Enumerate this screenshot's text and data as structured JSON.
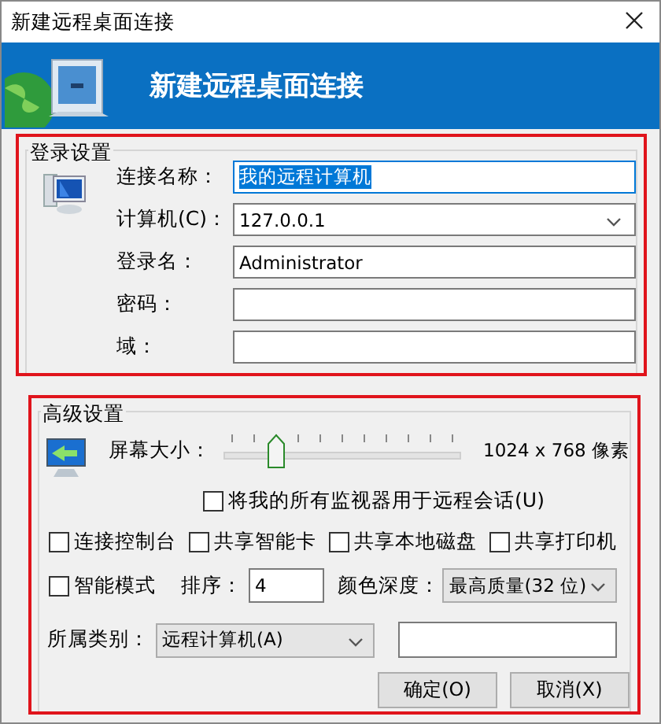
{
  "window": {
    "title": "新建远程桌面连接"
  },
  "banner": {
    "title": "新建远程桌面连接"
  },
  "login_settings": {
    "title": "登录设置",
    "fields": [
      {
        "kind": "text",
        "label": "连接名称：",
        "value": "我的远程计算机",
        "text_selected": true
      },
      {
        "kind": "combo",
        "label": "计算机(C)：",
        "value": "127.0.0.1",
        "text_selected": false
      },
      {
        "kind": "text",
        "label": "登录名：",
        "value": "Administrator",
        "text_selected": false
      },
      {
        "kind": "text",
        "label": "密码：",
        "text_selected": false
      },
      {
        "kind": "text",
        "label": "域：",
        "text_selected": false
      }
    ]
  },
  "advanced_settings": {
    "title": "高级设置",
    "screen_size": {
      "label": "屏幕大小：",
      "level": 0.2,
      "reading": "1024 x 768 像素"
    },
    "all_monitors": {
      "label": "将我的所有监视器用于远程会话(U)",
      "checked": false
    },
    "options": [
      {
        "label": "连接控制台",
        "checked": false
      },
      {
        "label": "共享智能卡",
        "checked": false
      },
      {
        "label": "共享本地磁盘",
        "checked": false
      },
      {
        "label": "共享打印机",
        "checked": false
      }
    ],
    "smart_mode": {
      "label": "智能模式",
      "checked": false
    },
    "order": {
      "label": "排序：",
      "value": "4"
    },
    "color_depth": {
      "label": "颜色深度：",
      "value": "最高质量(32 位)"
    },
    "category": {
      "label": "所属类别：",
      "value": "远程计算机(A)"
    }
  },
  "buttons": [
    {
      "label": "确定(O)"
    },
    {
      "label": "取消(X)"
    }
  ]
}
